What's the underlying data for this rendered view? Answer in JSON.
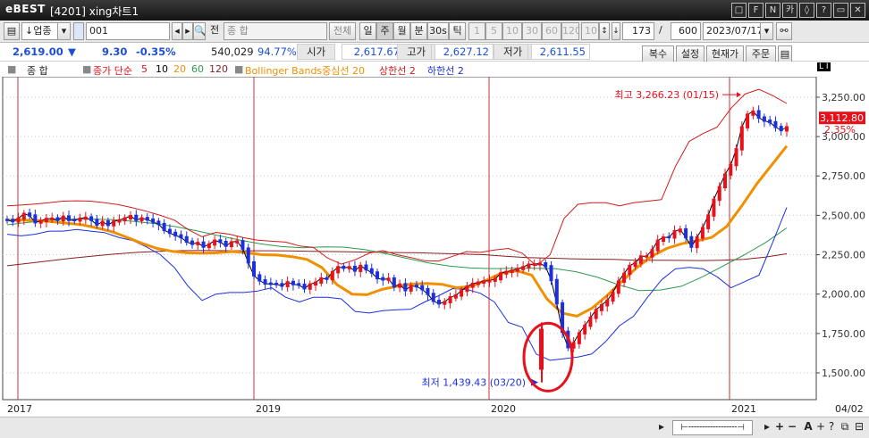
{
  "window": {
    "logo": "eBEST",
    "title": "[4201] xing차트1",
    "buttons": [
      "□",
      "F",
      "N",
      "카",
      "◊",
      "?",
      "▭",
      "✕"
    ]
  },
  "toolbar": {
    "market": "업종",
    "code": "001",
    "name": "종   합",
    "all_label": "전체",
    "periods": [
      "일",
      "주",
      "월",
      "분",
      "30s",
      "틱"
    ],
    "selected_period": "주",
    "minute_options": [
      "1",
      "5",
      "10",
      "30",
      "60",
      "120"
    ],
    "tick_value": "10",
    "count": "173",
    "total": "600",
    "date": "2023/07/17"
  },
  "quote": {
    "price": "2,619.00",
    "direction": "▼",
    "change": "9.30",
    "change_pct": "-0.35%",
    "volume": "540,029",
    "volume_pct": "94.77%",
    "open_label": "시가",
    "open": "2,617.67",
    "high_label": "고가",
    "high": "2,627.12",
    "low_label": "저가",
    "low": "2,611.55",
    "buttons": [
      "복수",
      "설정",
      "현재가",
      "주문"
    ]
  },
  "legend": {
    "name": "종   합",
    "ma_label": "종가 단순",
    "ma_periods": [
      "5",
      "10",
      "20",
      "60",
      "120"
    ],
    "bollinger": "Bollinger Bands중심선 20",
    "upper": "상한선 2",
    "lower": "하한선 2"
  },
  "annotations": {
    "high": "최고 3,266.23 (01/15)",
    "low": "최저 1,439.43 (03/20)",
    "current_price_tag": "3,112.80",
    "current_pct_tag": "2.35%"
  },
  "colors": {
    "up": "#e8101a",
    "down": "#1c2fe0",
    "ma5": "#e8101a",
    "ma10": "#000000",
    "ma20": "#f09000",
    "ma60": "#2a9a4a",
    "ma120": "#8a1e1e",
    "bb_upper": "#d21a1a",
    "bb_lower": "#1c2fe0",
    "highlight_circle": "#e8101a"
  },
  "chart_data": {
    "type": "candlestick",
    "x_labels": [
      "2017",
      "2019",
      "2020",
      "2021",
      "04/02"
    ],
    "y_ticks": [
      "3,250.00",
      "3,000.00",
      "2,750.00",
      "2,500.00",
      "2,250.00",
      "2,000.00",
      "1,750.00",
      "1,500.00"
    ],
    "y_values": [
      3250,
      3000,
      2750,
      2500,
      2250,
      2000,
      1750,
      1500
    ],
    "ylim": [
      1330,
      3380
    ],
    "series": [
      {
        "name": "종가 단순 5",
        "values": [
          2470,
          2462,
          2480,
          2510,
          2498,
          2455,
          2465,
          2478,
          2480,
          2470,
          2492,
          2470,
          2468,
          2480,
          2486,
          2470,
          2440,
          2460,
          2438,
          2462,
          2470,
          2482,
          2496,
          2470,
          2482,
          2472,
          2458,
          2444,
          2406,
          2388,
          2372,
          2360,
          2332,
          2318,
          2326,
          2300,
          2316,
          2340,
          2330,
          2306,
          2330,
          2335,
          2288,
          2200,
          2118,
          2086,
          2066,
          2064,
          2062,
          2052,
          2076,
          2062,
          2058,
          2036,
          2062,
          2074,
          2100,
          2096,
          2140,
          2172,
          2166,
          2172,
          2148,
          2180,
          2156,
          2136,
          2100,
          2092,
          2098,
          2048,
          2062,
          2024,
          2052,
          2048,
          2030,
          2000,
          1956,
          1940,
          1950,
          1980,
          1992,
          2022,
          2048,
          2066,
          2074,
          2082,
          2086,
          2096,
          2132,
          2142,
          2150,
          2160,
          2172,
          2188,
          2190,
          2194,
          2176,
          2088,
          1940,
          1760,
          1662,
          1690,
          1752,
          1800,
          1850,
          1900,
          1930,
          1960,
          2010,
          2080,
          2130,
          2180,
          2200,
          2240,
          2240,
          2280,
          2340,
          2360,
          2360,
          2400,
          2410,
          2360,
          2300,
          2360,
          2420,
          2500,
          2600,
          2680,
          2760,
          2820,
          2920,
          3060,
          3140,
          3160,
          3120,
          3100,
          3090,
          3060,
          3040,
          3060
        ]
      },
      {
        "name": "Bollinger Bands 상한선 2",
        "values": [
          2560,
          2565,
          2572,
          2580,
          2590,
          2592,
          2590,
          2580,
          2568,
          2548,
          2526,
          2500,
          2470,
          2410,
          2364,
          2392,
          2380,
          2358,
          2342,
          2336,
          2330,
          2306,
          2296,
          2230,
          2190,
          2218,
          2260,
          2276,
          2250,
          2232,
          2212,
          2210,
          2240,
          2270,
          2265,
          2280,
          2290,
          2260,
          2180,
          2250,
          2480,
          2570,
          2580,
          2580,
          2560,
          2580,
          2590,
          2600,
          2810,
          2970,
          3020,
          3060,
          3180,
          3270,
          3300,
          3260,
          3210
        ]
      },
      {
        "name": "Bollinger Bands 하한선 2",
        "values": [
          2380,
          2370,
          2380,
          2400,
          2400,
          2410,
          2400,
          2390,
          2360,
          2340,
          2300,
          2250,
          2170,
          2050,
          1960,
          2000,
          2010,
          2010,
          2020,
          2040,
          1980,
          1950,
          1980,
          1980,
          1970,
          1890,
          1880,
          1895,
          1900,
          1904,
          1950,
          1990,
          2035,
          2030,
          2005,
          1950,
          1820,
          1790,
          1620,
          1580,
          1590,
          1600,
          1620,
          1700,
          1800,
          1860,
          1980,
          2090,
          2160,
          2170,
          2160,
          2110,
          2040,
          2080,
          2120,
          2330,
          2550
        ]
      },
      {
        "name": "종가 단순 20",
        "values": [
          2470,
          2470,
          2466,
          2460,
          2450,
          2440,
          2420,
          2396,
          2360,
          2322,
          2290,
          2272,
          2262,
          2260,
          2262,
          2270,
          2262,
          2250,
          2248,
          2238,
          2220,
          2168,
          2060,
          2000,
          1996,
          2030,
          2050,
          2064,
          2068,
          2062,
          2040,
          2050,
          2090,
          2134,
          2148,
          2120,
          1970,
          1880,
          1860,
          1910,
          1990,
          2080,
          2168,
          2240,
          2290,
          2320,
          2338,
          2360,
          2430,
          2560,
          2700,
          2820,
          2940
        ]
      },
      {
        "name": "종가 단순 120",
        "values": [
          2180,
          2196,
          2212,
          2228,
          2242,
          2255,
          2265,
          2272,
          2276,
          2277,
          2276,
          2275,
          2275,
          2274,
          2272,
          2270,
          2268,
          2266,
          2264,
          2262,
          2258,
          2255,
          2250,
          2240,
          2232,
          2228,
          2224,
          2222,
          2220,
          2215,
          2215,
          2214,
          2213,
          2215,
          2220,
          2235,
          2256
        ]
      },
      {
        "name": "종가 단순 60",
        "values": [
          2440,
          2456,
          2470,
          2475,
          2476,
          2472,
          2462,
          2448,
          2428,
          2402,
          2372,
          2344,
          2320,
          2302,
          2294,
          2300,
          2298,
          2282,
          2256,
          2226,
          2198,
          2178,
          2166,
          2162,
          2164,
          2164,
          2162,
          2142,
          2108,
          2060,
          2022,
          2026,
          2050,
          2110,
          2180,
          2250,
          2328,
          2420
        ]
      }
    ],
    "high": {
      "value": 3266.23,
      "date": "01/15"
    },
    "low": {
      "value": 1439.43,
      "date": "03/20"
    },
    "candles_note": "weekly OHLC candles from 2017 to 2021"
  }
}
